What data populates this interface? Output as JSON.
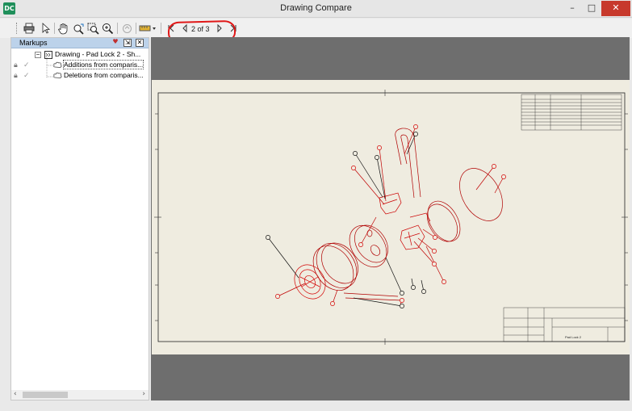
{
  "window": {
    "title": "Drawing Compare",
    "app_icon": "DC",
    "minimize_glyph": "–",
    "maximize_glyph": "□",
    "close_glyph": "✕"
  },
  "toolbar": {
    "page_indicator": "2 of 3",
    "icons": [
      "print-icon",
      "select-arrow-icon",
      "pan-hand-icon",
      "zoom-rotate-icon",
      "zoom-window-icon",
      "zoom-magnify-icon",
      "highlight-icon",
      "measure-icon",
      "first-page-icon",
      "previous-page-icon",
      "next-page-icon",
      "last-page-icon"
    ]
  },
  "markups_panel": {
    "title": "Markups",
    "tree": {
      "root": {
        "label": "Drawing - Pad Lock 2 - Sh..."
      },
      "children": [
        {
          "label": "Additions from comparis..."
        },
        {
          "label": "Deletions from comparis..."
        }
      ]
    }
  },
  "drawing": {
    "title_block": {
      "name": "Pad Lock 2"
    },
    "colors": {
      "sheet": "#efece0",
      "additions": "#d40000",
      "linework": "#000000"
    }
  }
}
